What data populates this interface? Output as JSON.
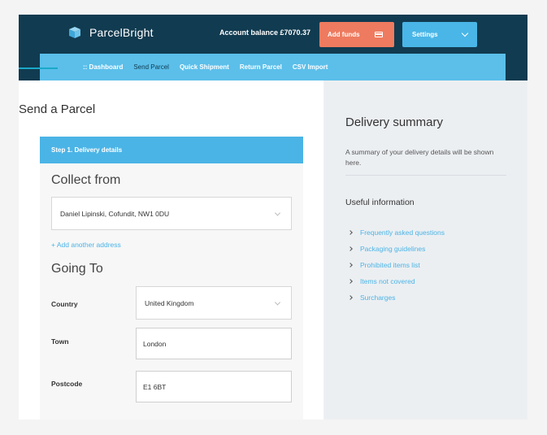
{
  "header": {
    "brand": "ParcelBright",
    "balance_text": "Account balance £7070.37",
    "add_funds_label": "Add funds",
    "settings_label": "Settings"
  },
  "nav": {
    "dashboard_label": ":: Dashboard",
    "items": [
      "Send Parcel",
      "Quick Shipment",
      "Return Parcel",
      "CSV Import"
    ]
  },
  "form": {
    "page_title": "Send a Parcel",
    "step_label": "Step 1. Delivery details",
    "collect_heading": "Collect from",
    "collect_value": "Daniel Lipinski, Cofundit, NW1 0DU",
    "add_address_label": "+ Add another address",
    "going_heading": "Going To",
    "country_label": "Country",
    "country_value": "United Kingdom",
    "town_label": "Town",
    "town_value": "London",
    "postcode_label": "Postcode",
    "postcode_value": "E1 6BT"
  },
  "summary": {
    "title": "Delivery summary",
    "text": "A summary of your delivery details will be shown here.",
    "useful_heading": "Useful information",
    "links": [
      "Frequently asked questions",
      "Packaging guidelines",
      "Prohibited items list",
      "Items not covered",
      "Surcharges"
    ]
  },
  "colors": {
    "navy": "#113b50",
    "sky": "#5bbfea",
    "accent": "#4bb4e6",
    "orange": "#ee7b5f"
  },
  "icons": {
    "brand": "folded-box-icon",
    "funds": "credit-card-icon",
    "settings": "chevron-down-icon"
  }
}
